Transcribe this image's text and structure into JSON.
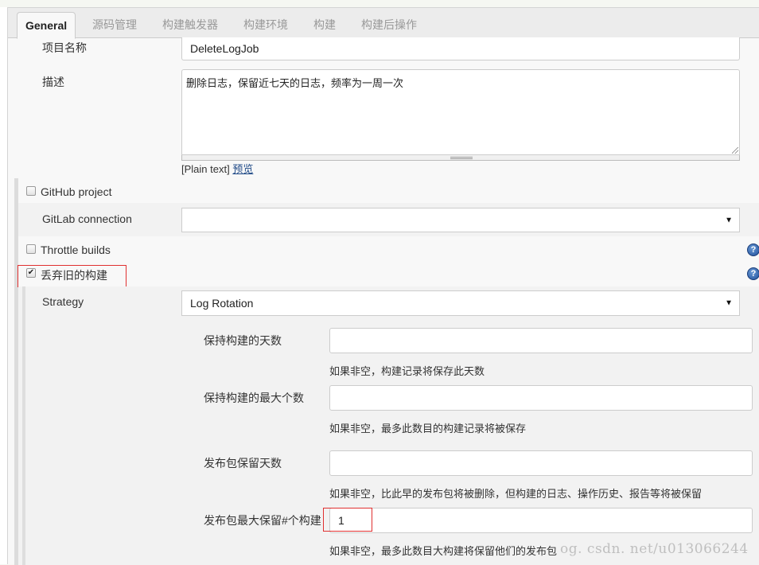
{
  "tabs": [
    {
      "label": "General",
      "active": true
    },
    {
      "label": "源码管理",
      "active": false
    },
    {
      "label": "构建触发器",
      "active": false
    },
    {
      "label": "构建环境",
      "active": false
    },
    {
      "label": "构建",
      "active": false
    },
    {
      "label": "构建后操作",
      "active": false
    }
  ],
  "project_name": {
    "label": "项目名称",
    "value": "DeleteLogJob"
  },
  "description": {
    "label": "描述",
    "value": "删除日志，保留近七天的日志，频率为一周一次",
    "format_note": "[Plain text]",
    "preview_link": "预览"
  },
  "github_project": {
    "label": "GitHub project",
    "checked": false
  },
  "gitlab_connection": {
    "label": "GitLab connection",
    "value": ""
  },
  "throttle_builds": {
    "label": "Throttle builds",
    "checked": false
  },
  "discard_old_builds": {
    "label": "丢弃旧的构建",
    "checked": true,
    "checkmark": "✔"
  },
  "strategy": {
    "label": "Strategy",
    "value": "Log Rotation"
  },
  "dropdown_arrow": "▼",
  "help_glyph": "?",
  "fields": {
    "days_to_keep": {
      "label": "保持构建的天数",
      "value": "",
      "hint": "如果非空，构建记录将保存此天数"
    },
    "max_builds": {
      "label": "保持构建的最大个数",
      "value": "",
      "hint": "如果非空，最多此数目的构建记录将被保存"
    },
    "artifact_days": {
      "label": "发布包保留天数",
      "value": "",
      "hint": "如果非空，比此早的发布包将被删除，但构建的日志、操作历史、报告等将被保留"
    },
    "artifact_max": {
      "label": "发布包最大保留#个构建",
      "value": "1",
      "hint": "如果非空，最多此数目大构建将保留他们的发布包"
    }
  },
  "watermark": "og. csdn. net/u013066244"
}
